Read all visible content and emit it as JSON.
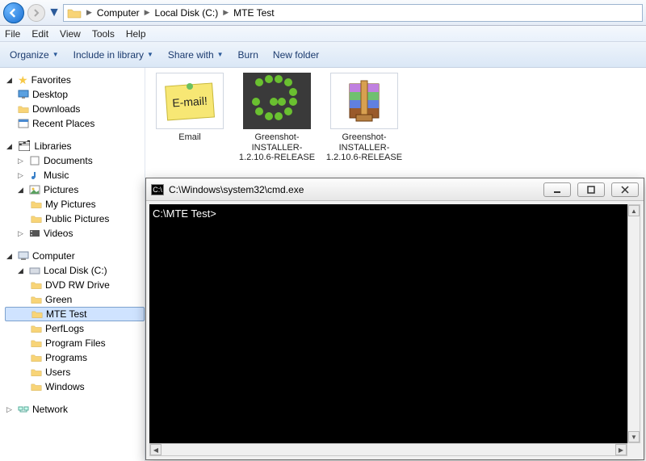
{
  "breadcrumb": {
    "segments": [
      "Computer",
      "Local Disk (C:)",
      "MTE Test"
    ]
  },
  "menu": [
    "File",
    "Edit",
    "View",
    "Tools",
    "Help"
  ],
  "toolbar": {
    "organize": "Organize",
    "include": "Include in library",
    "share": "Share with",
    "burn": "Burn",
    "newfolder": "New folder"
  },
  "sidebar": {
    "favorites": {
      "label": "Favorites",
      "items": [
        "Desktop",
        "Downloads",
        "Recent Places"
      ]
    },
    "libraries": {
      "label": "Libraries",
      "items": [
        {
          "label": "Documents"
        },
        {
          "label": "Music"
        },
        {
          "label": "Pictures",
          "children": [
            "My Pictures",
            "Public Pictures"
          ]
        },
        {
          "label": "Videos"
        }
      ]
    },
    "computer": {
      "label": "Computer",
      "disk": "Local Disk (C:)",
      "folders": [
        "DVD RW Drive",
        "Green",
        "MTE Test",
        "PerfLogs",
        "Program Files",
        "Programs",
        "Users",
        "Windows"
      ]
    },
    "network": "Network"
  },
  "files": [
    {
      "name": "Email",
      "thumb": "email"
    },
    {
      "name": "Greenshot-INSTALLER-1.2.10.6-RELEASE",
      "thumb": "greenshot"
    },
    {
      "name": "Greenshot-INSTALLER-1.2.10.6-RELEASE",
      "thumb": "rar"
    }
  ],
  "cmd": {
    "title": "C:\\Windows\\system32\\cmd.exe",
    "prompt": "C:\\MTE Test>"
  }
}
